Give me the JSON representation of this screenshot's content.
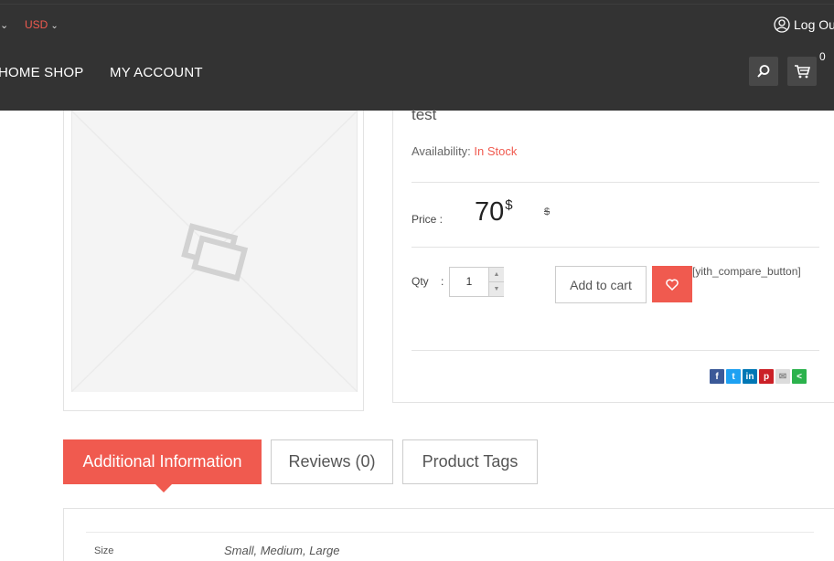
{
  "header": {
    "currency": "USD",
    "logout_label": "Log Out",
    "nav": [
      "HOME SHOP",
      "MY ACCOUNT"
    ],
    "cart_count": "0",
    "icons": [
      "chevron-down-icon",
      "user-icon",
      "search-icon",
      "cart-icon"
    ]
  },
  "product": {
    "title": "test",
    "availability_label": "Availability:",
    "availability_value": "In Stock",
    "price_label": "Price :",
    "price_value": "70",
    "price_currency": "$",
    "old_price": "$",
    "qty_label": "Qty",
    "qty_colon": ":",
    "qty_value": "1",
    "add_to_cart": "Add to cart",
    "compare_shortcode": "[yith_compare_button]",
    "share_icons": [
      "facebook-icon",
      "twitter-icon",
      "linkedin-icon",
      "pinterest-icon",
      "email-icon",
      "share-icon"
    ]
  },
  "tabs": [
    {
      "label": "Additional Information",
      "active": true
    },
    {
      "label": "Reviews (0)",
      "active": false
    },
    {
      "label": "Product Tags",
      "active": false
    }
  ],
  "attributes": [
    {
      "name": "Size",
      "value": "Small, Medium, Large"
    }
  ],
  "colors": {
    "accent": "#f05a4f",
    "header_bg": "#333333"
  }
}
